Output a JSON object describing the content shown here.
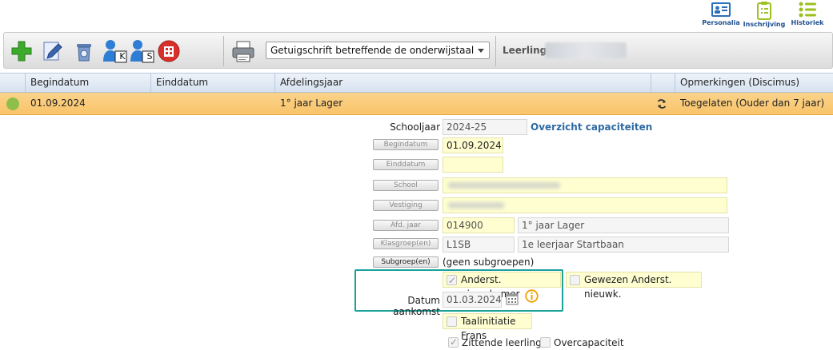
{
  "topnav": [
    {
      "label": "Personalia",
      "icon": "id-card-icon"
    },
    {
      "label": "Inschrijving",
      "icon": "clipboard-icon"
    },
    {
      "label": "Historiek",
      "icon": "list-icon"
    }
  ],
  "toolbar": {
    "document_select": "Getuigschrift betreffende de onderwijstaal",
    "leerling_label": "Leerling:",
    "user_badge_k": "K",
    "user_badge_s": "S"
  },
  "grid": {
    "headers": [
      "Begindatum",
      "Einddatum",
      "Afdelingsjaar",
      "Opmerkingen (Discimus)"
    ],
    "row": {
      "begindatum": "01.09.2024",
      "einddatum": "",
      "afdelingsjaar": "1° jaar Lager",
      "opmerkingen": "Toegelaten (Ouder dan 7 jaar)"
    }
  },
  "form": {
    "schooljaar_label": "Schooljaar",
    "schooljaar_value": "2024-25",
    "overzicht_link": "Overzicht capaciteiten",
    "begindatum_btn": "Begindatum",
    "begindatum_value": "01.09.2024",
    "einddatum_btn": "Einddatum",
    "einddatum_value": "",
    "school_btn": "School",
    "vestiging_btn": "Vestiging",
    "afd_jaar_btn": "Afd. jaar",
    "afd_jaar_code": "014900",
    "afd_jaar_name": "1° jaar Lager",
    "klasgroep_btn": "Klasgroep(en)",
    "klasgroep_code": "L1SB",
    "klasgroep_name": "1e leerjaar Startbaan",
    "subgroep_btn": "Subgroep(en)",
    "subgroep_value": "(geen subgroepen)",
    "anderst_nieuwkomer": "Anderst. nieuwkomer",
    "gewezen_anderst": "Gewezen Anderst. nieuwk.",
    "datum_aankomst_label": "Datum aankomst",
    "datum_aankomst_value": "01.03.2024",
    "taalinitiatie": "Taalinitiatie Frans",
    "zittende_leerling": "Zittende leerling",
    "overcapaciteit": "Overcapaciteit"
  },
  "colors": {
    "row_highlight": "#f9c46b",
    "yellow_field": "#fefed0",
    "link_blue": "#2e6aa3",
    "highlight_teal": "#1aa19a"
  }
}
